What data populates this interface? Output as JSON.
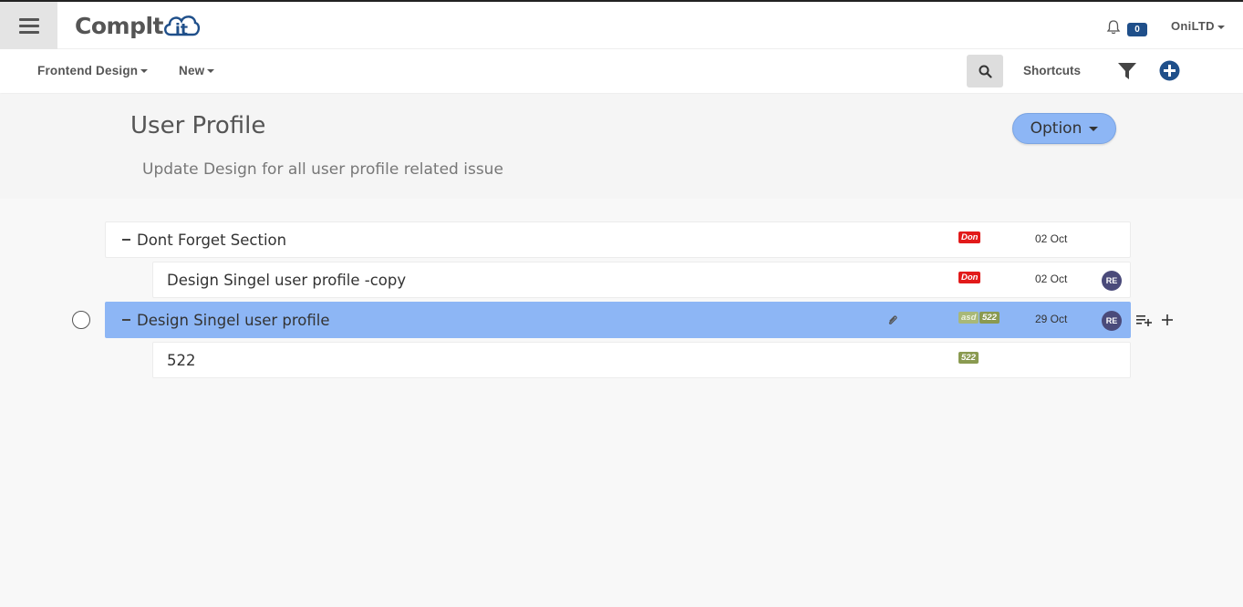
{
  "app": {
    "logo_text": "Complt",
    "logo_accent": "it",
    "brand_color": "#1f4f8a"
  },
  "topbar": {
    "notification_count": "0",
    "org_name": "OniLTD"
  },
  "subbar": {
    "project_menu": "Frontend Design",
    "new_menu": "New",
    "shortcuts_label": "Shortcuts"
  },
  "page": {
    "title": "User Profile",
    "description": "Update Design for all user profile related issue",
    "option_label": "Option"
  },
  "rows": [
    {
      "title": "Dont Forget Section",
      "tags": [
        "Don"
      ],
      "date": "02 Oct",
      "avatar": ""
    },
    {
      "title": "Design Singel user profile -copy",
      "tags": [
        "Don"
      ],
      "date": "02 Oct",
      "avatar": "RE"
    },
    {
      "title": "Design Singel user profile",
      "tags": [
        "asd",
        "522"
      ],
      "date": "29 Oct",
      "avatar": "RE"
    },
    {
      "title": "522",
      "tags": [
        "522"
      ],
      "date": "",
      "avatar": ""
    }
  ],
  "colors": {
    "selected_row": "#8db6f5",
    "tag_red": "#e21a1a",
    "tag_olive": "#8a9a50",
    "avatar": "#4a4a7a"
  }
}
